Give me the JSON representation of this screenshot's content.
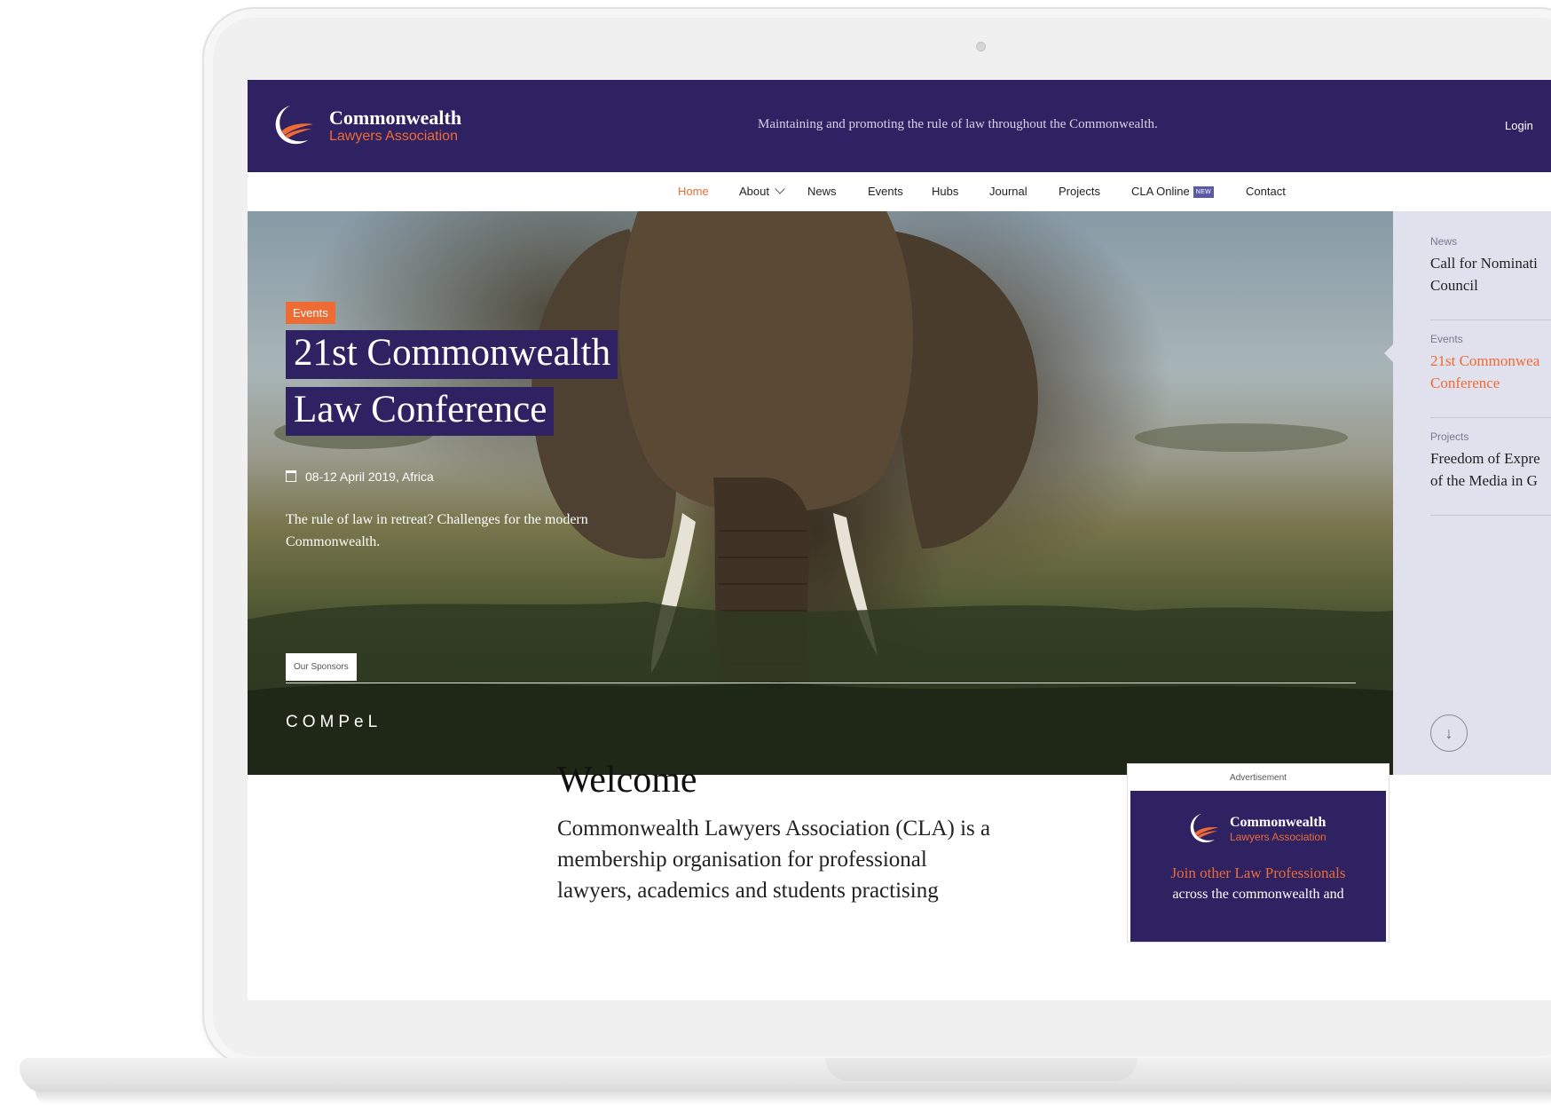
{
  "header": {
    "logo": {
      "line1": "Commonwealth",
      "line2": "Lawyers Association"
    },
    "tagline": "Maintaining and promoting the rule of law throughout the Commonwealth.",
    "login_label": "Login"
  },
  "nav": {
    "items": [
      {
        "label": "Home",
        "active": true
      },
      {
        "label": "About",
        "has_dropdown": true
      },
      {
        "label": "News"
      },
      {
        "label": "Events"
      },
      {
        "label": "Hubs"
      },
      {
        "label": "Journal"
      },
      {
        "label": "Projects"
      },
      {
        "label": "CLA Online",
        "badge": "NEW"
      },
      {
        "label": "Contact"
      }
    ]
  },
  "hero": {
    "category": "Events",
    "title": "21st Commonwealth Law Conference",
    "date": "08-12 April 2019, Africa",
    "description": "The rule of law in retreat? Challenges for the modern Commonwealth.",
    "sponsors_label": "Our Sponsors",
    "sponsor_name": "COMPeL"
  },
  "side_panel": {
    "items": [
      {
        "category": "News",
        "title_line1": "Call for Nominati",
        "title_line2": "Council",
        "active": false
      },
      {
        "category": "Events",
        "title_line1": "21st Commonwea",
        "title_line2": "Conference",
        "active": true
      },
      {
        "category": "Projects",
        "title_line1": "Freedom of Expre",
        "title_line2": "of the Media in G",
        "active": false
      }
    ],
    "scroll_icon": "arrow-down-icon"
  },
  "welcome": {
    "title": "Welcome",
    "line1": "Commonwealth Lawyers Association (CLA) is a",
    "line2": "membership organisation for professional",
    "line3": "lawyers, academics and students practising"
  },
  "advertisement": {
    "label": "Advertisement",
    "logo_line1": "Commonwealth",
    "logo_line2": "Lawyers Association",
    "join": "Join other Law Professionals",
    "across": "across the commonwealth and"
  },
  "colors": {
    "brand_purple": "#2e2263",
    "accent_orange": "#ee6b34",
    "panel_lavender": "#e1e0ed",
    "badge_blue": "#5b5aa6"
  }
}
